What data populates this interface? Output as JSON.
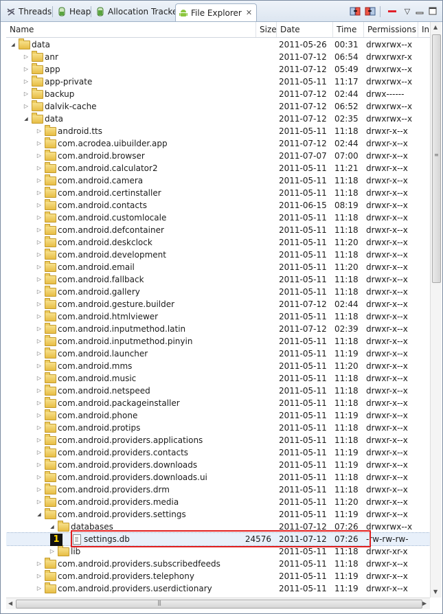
{
  "tabs": [
    {
      "label": "Threads",
      "icon": "threads-icon"
    },
    {
      "label": "Heap",
      "icon": "heap-icon"
    },
    {
      "label": "Allocation Tracker",
      "icon": "allocation-icon"
    },
    {
      "label": "File Explorer",
      "icon": "android-icon",
      "active": true
    }
  ],
  "toolbar": [
    "pull-file-icon",
    "push-file-icon",
    "delete-icon",
    "view-menu-icon",
    "minimize-icon",
    "maximize-icon"
  ],
  "columns": {
    "name": "Name",
    "size": "Size",
    "date": "Date",
    "time": "Time",
    "permissions": "Permissions",
    "info": "In"
  },
  "rows": [
    {
      "name": "data",
      "date": "2011-05-26",
      "time": "00:31",
      "perm": "drwxrwx--x",
      "depth": 0,
      "state": "open",
      "type": "folder"
    },
    {
      "name": "anr",
      "date": "2011-07-12",
      "time": "06:54",
      "perm": "drwxrwxr-x",
      "depth": 1,
      "state": "closed",
      "type": "folder"
    },
    {
      "name": "app",
      "date": "2011-07-12",
      "time": "05:49",
      "perm": "drwxrwx--x",
      "depth": 1,
      "state": "closed",
      "type": "folder"
    },
    {
      "name": "app-private",
      "date": "2011-05-11",
      "time": "11:17",
      "perm": "drwxrwx--x",
      "depth": 1,
      "state": "closed",
      "type": "folder"
    },
    {
      "name": "backup",
      "date": "2011-07-12",
      "time": "02:44",
      "perm": "drwx------",
      "depth": 1,
      "state": "closed",
      "type": "folder"
    },
    {
      "name": "dalvik-cache",
      "date": "2011-07-12",
      "time": "06:52",
      "perm": "drwxrwx--x",
      "depth": 1,
      "state": "closed",
      "type": "folder"
    },
    {
      "name": "data",
      "date": "2011-07-12",
      "time": "02:35",
      "perm": "drwxrwx--x",
      "depth": 1,
      "state": "open",
      "type": "folder"
    },
    {
      "name": "android.tts",
      "date": "2011-05-11",
      "time": "11:18",
      "perm": "drwxr-x--x",
      "depth": 2,
      "state": "closed",
      "type": "folder"
    },
    {
      "name": "com.acrodea.uibuilder.app",
      "date": "2011-07-12",
      "time": "02:44",
      "perm": "drwxr-x--x",
      "depth": 2,
      "state": "closed",
      "type": "folder"
    },
    {
      "name": "com.android.browser",
      "date": "2011-07-07",
      "time": "07:00",
      "perm": "drwxr-x--x",
      "depth": 2,
      "state": "closed",
      "type": "folder"
    },
    {
      "name": "com.android.calculator2",
      "date": "2011-05-11",
      "time": "11:21",
      "perm": "drwxr-x--x",
      "depth": 2,
      "state": "closed",
      "type": "folder"
    },
    {
      "name": "com.android.camera",
      "date": "2011-05-11",
      "time": "11:18",
      "perm": "drwxr-x--x",
      "depth": 2,
      "state": "closed",
      "type": "folder"
    },
    {
      "name": "com.android.certinstaller",
      "date": "2011-05-11",
      "time": "11:18",
      "perm": "drwxr-x--x",
      "depth": 2,
      "state": "closed",
      "type": "folder"
    },
    {
      "name": "com.android.contacts",
      "date": "2011-06-15",
      "time": "08:19",
      "perm": "drwxr-x--x",
      "depth": 2,
      "state": "closed",
      "type": "folder"
    },
    {
      "name": "com.android.customlocale",
      "date": "2011-05-11",
      "time": "11:18",
      "perm": "drwxr-x--x",
      "depth": 2,
      "state": "closed",
      "type": "folder"
    },
    {
      "name": "com.android.defcontainer",
      "date": "2011-05-11",
      "time": "11:18",
      "perm": "drwxr-x--x",
      "depth": 2,
      "state": "closed",
      "type": "folder"
    },
    {
      "name": "com.android.deskclock",
      "date": "2011-05-11",
      "time": "11:20",
      "perm": "drwxr-x--x",
      "depth": 2,
      "state": "closed",
      "type": "folder"
    },
    {
      "name": "com.android.development",
      "date": "2011-05-11",
      "time": "11:18",
      "perm": "drwxr-x--x",
      "depth": 2,
      "state": "closed",
      "type": "folder"
    },
    {
      "name": "com.android.email",
      "date": "2011-05-11",
      "time": "11:20",
      "perm": "drwxr-x--x",
      "depth": 2,
      "state": "closed",
      "type": "folder"
    },
    {
      "name": "com.android.fallback",
      "date": "2011-05-11",
      "time": "11:18",
      "perm": "drwxr-x--x",
      "depth": 2,
      "state": "closed",
      "type": "folder"
    },
    {
      "name": "com.android.gallery",
      "date": "2011-05-11",
      "time": "11:18",
      "perm": "drwxr-x--x",
      "depth": 2,
      "state": "closed",
      "type": "folder"
    },
    {
      "name": "com.android.gesture.builder",
      "date": "2011-07-12",
      "time": "02:44",
      "perm": "drwxr-x--x",
      "depth": 2,
      "state": "closed",
      "type": "folder"
    },
    {
      "name": "com.android.htmlviewer",
      "date": "2011-05-11",
      "time": "11:18",
      "perm": "drwxr-x--x",
      "depth": 2,
      "state": "closed",
      "type": "folder"
    },
    {
      "name": "com.android.inputmethod.latin",
      "date": "2011-07-12",
      "time": "02:39",
      "perm": "drwxr-x--x",
      "depth": 2,
      "state": "closed",
      "type": "folder"
    },
    {
      "name": "com.android.inputmethod.pinyin",
      "date": "2011-05-11",
      "time": "11:18",
      "perm": "drwxr-x--x",
      "depth": 2,
      "state": "closed",
      "type": "folder"
    },
    {
      "name": "com.android.launcher",
      "date": "2011-05-11",
      "time": "11:19",
      "perm": "drwxr-x--x",
      "depth": 2,
      "state": "closed",
      "type": "folder"
    },
    {
      "name": "com.android.mms",
      "date": "2011-05-11",
      "time": "11:20",
      "perm": "drwxr-x--x",
      "depth": 2,
      "state": "closed",
      "type": "folder"
    },
    {
      "name": "com.android.music",
      "date": "2011-05-11",
      "time": "11:18",
      "perm": "drwxr-x--x",
      "depth": 2,
      "state": "closed",
      "type": "folder"
    },
    {
      "name": "com.android.netspeed",
      "date": "2011-05-11",
      "time": "11:18",
      "perm": "drwxr-x--x",
      "depth": 2,
      "state": "closed",
      "type": "folder"
    },
    {
      "name": "com.android.packageinstaller",
      "date": "2011-05-11",
      "time": "11:18",
      "perm": "drwxr-x--x",
      "depth": 2,
      "state": "closed",
      "type": "folder"
    },
    {
      "name": "com.android.phone",
      "date": "2011-05-11",
      "time": "11:19",
      "perm": "drwxr-x--x",
      "depth": 2,
      "state": "closed",
      "type": "folder"
    },
    {
      "name": "com.android.protips",
      "date": "2011-05-11",
      "time": "11:18",
      "perm": "drwxr-x--x",
      "depth": 2,
      "state": "closed",
      "type": "folder"
    },
    {
      "name": "com.android.providers.applications",
      "date": "2011-05-11",
      "time": "11:18",
      "perm": "drwxr-x--x",
      "depth": 2,
      "state": "closed",
      "type": "folder"
    },
    {
      "name": "com.android.providers.contacts",
      "date": "2011-05-11",
      "time": "11:19",
      "perm": "drwxr-x--x",
      "depth": 2,
      "state": "closed",
      "type": "folder"
    },
    {
      "name": "com.android.providers.downloads",
      "date": "2011-05-11",
      "time": "11:19",
      "perm": "drwxr-x--x",
      "depth": 2,
      "state": "closed",
      "type": "folder"
    },
    {
      "name": "com.android.providers.downloads.ui",
      "date": "2011-05-11",
      "time": "11:18",
      "perm": "drwxr-x--x",
      "depth": 2,
      "state": "closed",
      "type": "folder"
    },
    {
      "name": "com.android.providers.drm",
      "date": "2011-05-11",
      "time": "11:18",
      "perm": "drwxr-x--x",
      "depth": 2,
      "state": "closed",
      "type": "folder"
    },
    {
      "name": "com.android.providers.media",
      "date": "2011-05-11",
      "time": "11:20",
      "perm": "drwxr-x--x",
      "depth": 2,
      "state": "closed",
      "type": "folder"
    },
    {
      "name": "com.android.providers.settings",
      "date": "2011-05-11",
      "time": "11:19",
      "perm": "drwxr-x--x",
      "depth": 2,
      "state": "open",
      "type": "folder"
    },
    {
      "name": "databases",
      "date": "2011-07-12",
      "time": "07:26",
      "perm": "drwxrwx--x",
      "depth": 3,
      "state": "open",
      "type": "folder"
    },
    {
      "name": "settings.db",
      "size": "24576",
      "date": "2011-07-12",
      "time": "07:26",
      "perm": "-rw-rw-rw-",
      "depth": 4,
      "state": "none",
      "type": "file",
      "selected": true
    },
    {
      "name": "lib",
      "date": "2011-05-11",
      "time": "11:18",
      "perm": "drwxr-xr-x",
      "depth": 3,
      "state": "closed",
      "type": "folder"
    },
    {
      "name": "com.android.providers.subscribedfeeds",
      "date": "2011-05-11",
      "time": "11:18",
      "perm": "drwxr-x--x",
      "depth": 2,
      "state": "closed",
      "type": "folder"
    },
    {
      "name": "com.android.providers.telephony",
      "date": "2011-05-11",
      "time": "11:19",
      "perm": "drwxr-x--x",
      "depth": 2,
      "state": "closed",
      "type": "folder"
    },
    {
      "name": "com.android.providers.userdictionary",
      "date": "2011-05-11",
      "time": "11:19",
      "perm": "drwxr-x--x",
      "depth": 2,
      "state": "closed",
      "type": "folder"
    }
  ],
  "annotation": {
    "badge": "1",
    "color": "#e01e1e"
  }
}
